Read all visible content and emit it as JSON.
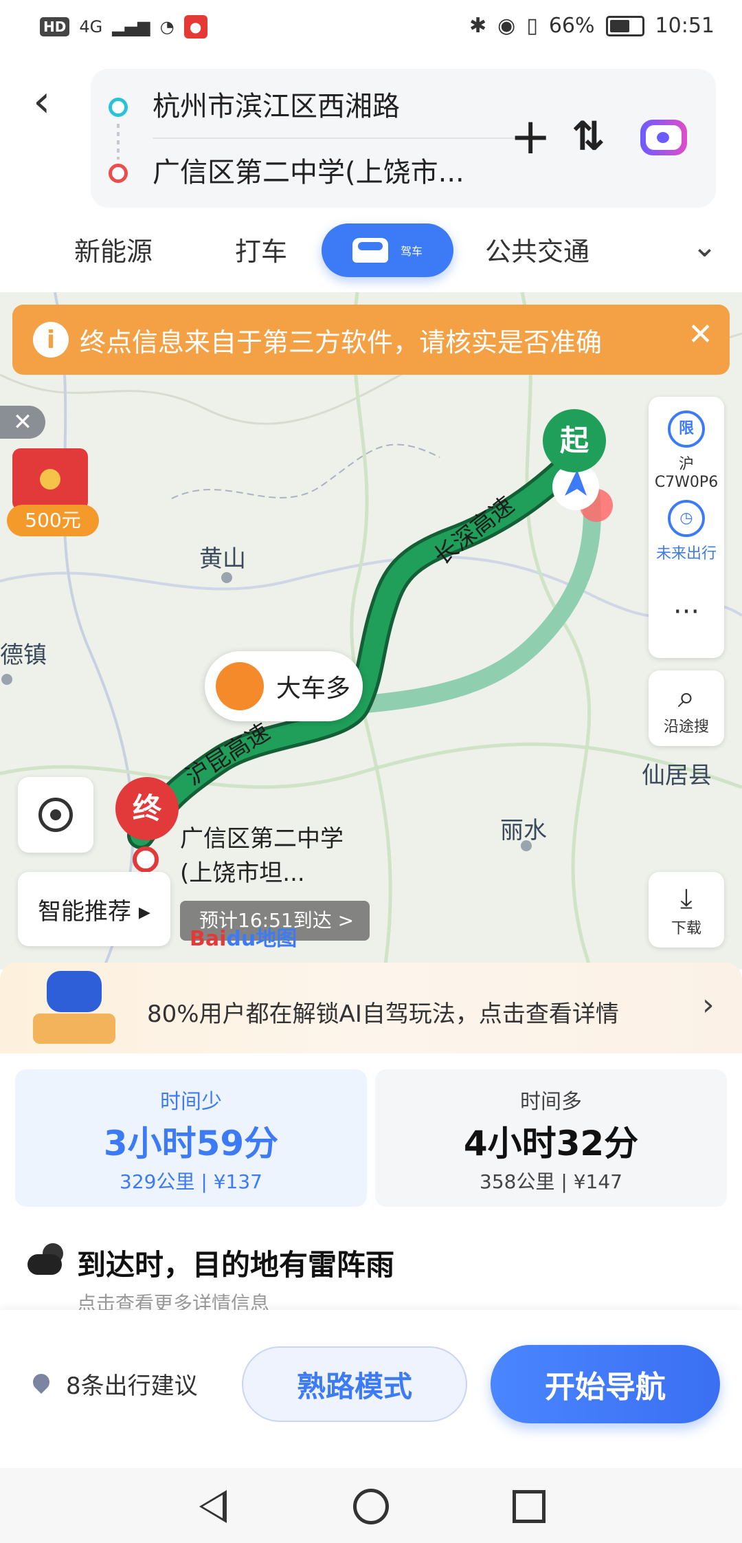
{
  "status_bar": {
    "left_badge": "HD",
    "network": "4G",
    "battery": "66%",
    "time": "10:51"
  },
  "route": {
    "from": "杭州市滨江区西湘路",
    "to": "广信区第二中学(上饶市..."
  },
  "tabs": [
    "新能源",
    "打车",
    "驾车",
    "公共交通"
  ],
  "active_tab": "驾车",
  "notice": {
    "text": "终点信息来自于第三方软件，请核实是否准确"
  },
  "promo": {
    "amount": "500元"
  },
  "side_tools": {
    "plate": "沪C7W0P6",
    "future_trip": "未来出行",
    "more": "···",
    "search_along": "沿途搜",
    "download": "下载"
  },
  "map": {
    "labels": {
      "huangshan": "黄山",
      "lishui": "丽水",
      "xianju": "仙居县",
      "town": "德镇",
      "expressway_north": "长深高速",
      "expressway_south": "沪昆高速"
    },
    "truck_tip": "大车多",
    "start_label": "起",
    "end_label": "终",
    "destination": "广信区第二中学",
    "destination_line2": "(上饶市坦...",
    "eta_pill": "预计16:51到达 >",
    "smart_sort": "智能推荐 ▸",
    "logo_part1": "Bai",
    "logo_part2": "du地图"
  },
  "banner": {
    "text": "80%用户都在解锁AI自驾玩法，点击查看详情",
    "arrow": "›"
  },
  "route_options": [
    {
      "tag": "时间少",
      "duration": "3小时59分",
      "distance": "329公里",
      "toll": "¥137"
    },
    {
      "tag": "时间多",
      "duration": "4小时32分",
      "distance": "358公里",
      "toll": "¥147"
    }
  ],
  "weather": {
    "text": "到达时，目的地有雷阵雨",
    "sub": "点击查看更多详情信息"
  },
  "bottom": {
    "advice": "8条出行建议",
    "familiar_mode": "熟路模式",
    "start_nav": "开始导航"
  },
  "colors": {
    "primary": "#3d7bf6",
    "route_green": "#1f9f5a",
    "alt_route": "#8fcfb0",
    "notice_orange": "#f3a144",
    "end_red": "#e23a3a"
  }
}
